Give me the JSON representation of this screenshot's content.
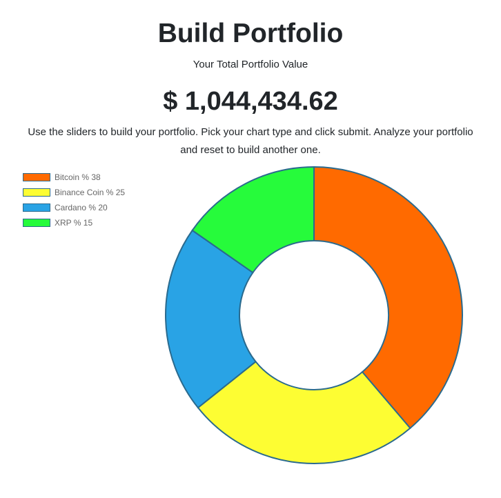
{
  "header": {
    "title": "Build Portfolio",
    "subtitle": "Your Total Portfolio Value",
    "total_value": "$ 1,044,434.62",
    "instructions": "Use the sliders to build your portfolio. Pick your chart type and click submit. Analyze your portfolio and reset to build another one."
  },
  "chart_data": {
    "type": "pie",
    "variant": "doughnut",
    "categories": [
      "Bitcoin",
      "Binance Coin",
      "Cardano",
      "XRP"
    ],
    "values": [
      38,
      25,
      20,
      15
    ],
    "legend_labels": [
      "Bitcoin % 38",
      "Binance Coin % 25",
      "Cardano % 20",
      "XRP % 15"
    ],
    "colors": [
      "#ff6a00",
      "#fdfd33",
      "#29a3e5",
      "#26fb3b"
    ],
    "border_color": "#2a6a8e",
    "legend_position": "top-left"
  }
}
